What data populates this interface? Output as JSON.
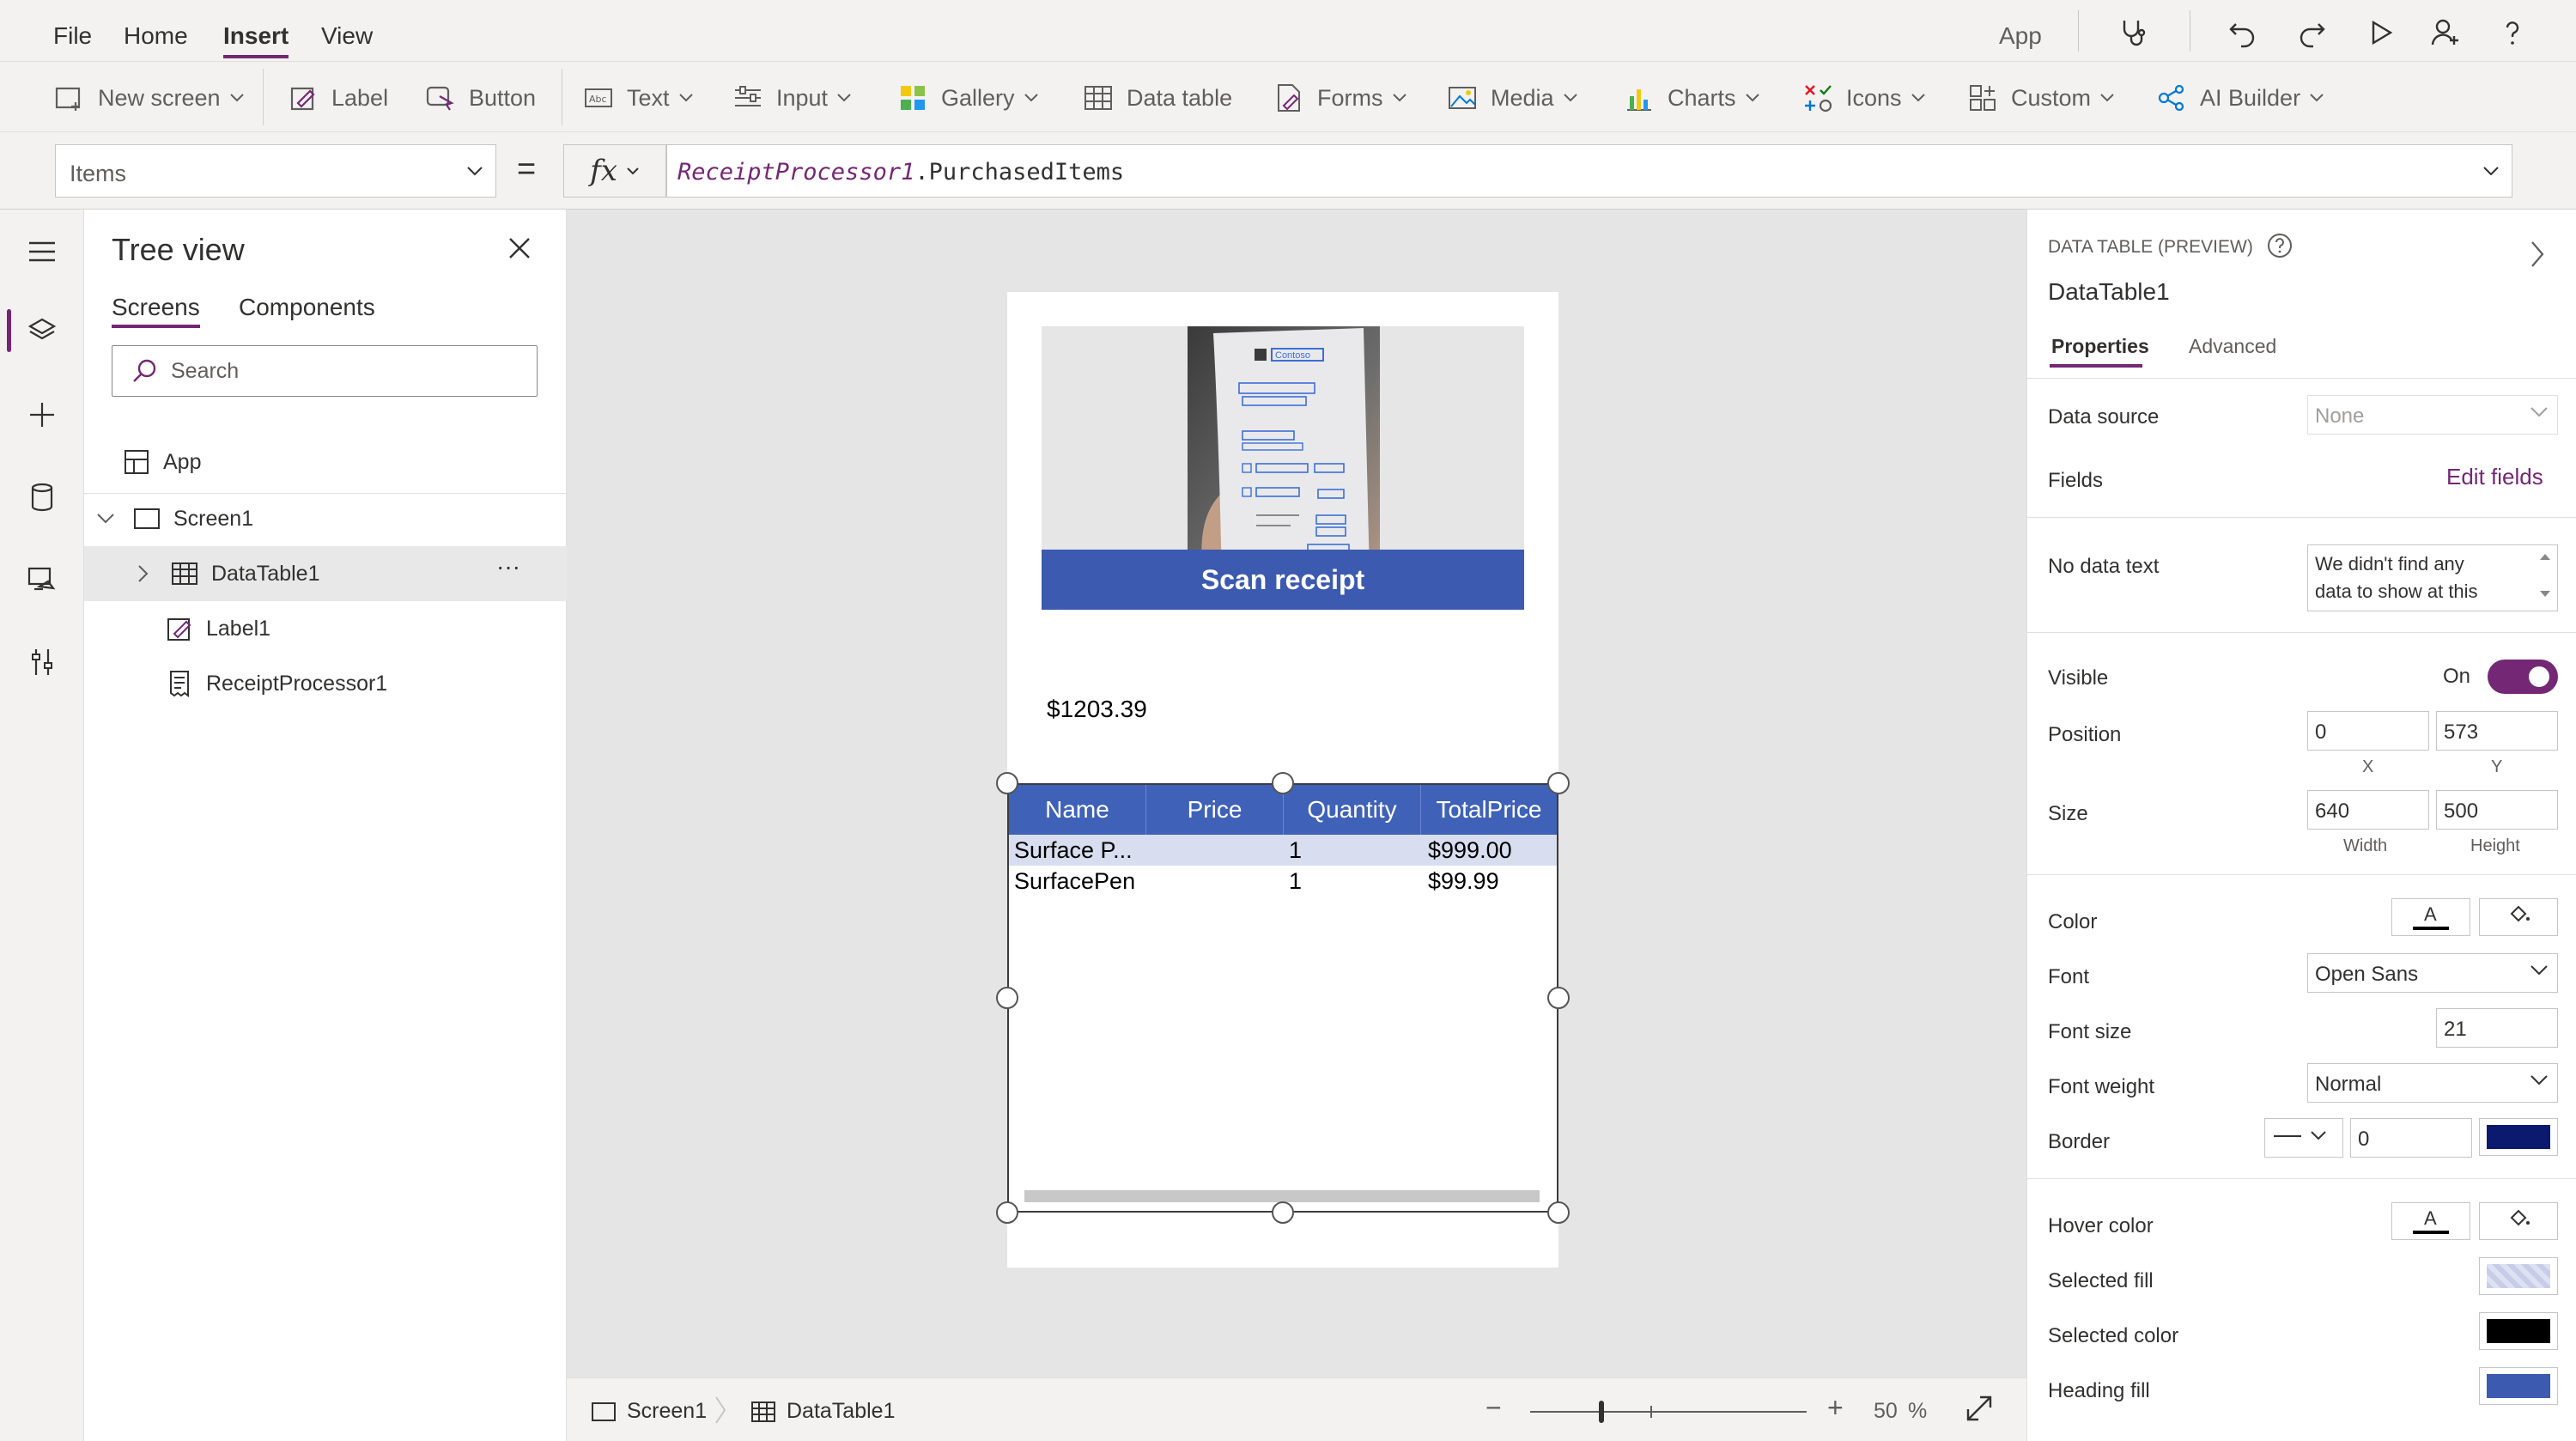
{
  "menu": {
    "file": "File",
    "home": "Home",
    "insert": "Insert",
    "view": "View",
    "app_label": "App"
  },
  "ribbon": {
    "new_screen": "New screen",
    "label": "Label",
    "button": "Button",
    "text": "Text",
    "input": "Input",
    "gallery": "Gallery",
    "data_table": "Data table",
    "forms": "Forms",
    "media": "Media",
    "charts": "Charts",
    "icons": "Icons",
    "custom": "Custom",
    "ai_builder": "AI Builder"
  },
  "formula": {
    "property": "Items",
    "equals": "=",
    "fx": "fx",
    "object": "ReceiptProcessor1",
    "member": ".PurchasedItems"
  },
  "tree": {
    "title": "Tree view",
    "tabs": [
      "Screens",
      "Components"
    ],
    "search_placeholder": "Search",
    "items": {
      "app": "App",
      "screen1": "Screen1",
      "datatable1": "DataTable1",
      "label1": "Label1",
      "receipt": "ReceiptProcessor1"
    },
    "more": "···"
  },
  "canvas": {
    "scan_button": "Scan receipt",
    "total": "$1203.39",
    "receipt_brand": "Contoso",
    "table": {
      "headers": [
        "Name",
        "Price",
        "Quantity",
        "TotalPrice"
      ],
      "rows": [
        [
          "Surface P...",
          "",
          "1",
          "$999.00"
        ],
        [
          "SurfacePen",
          "",
          "1",
          "$99.99"
        ]
      ]
    }
  },
  "status": {
    "screen": "Screen1",
    "control": "DataTable1",
    "minus": "−",
    "plus": "+",
    "zoom": "50",
    "zoom_unit": "%"
  },
  "props": {
    "type": "DATA TABLE (PREVIEW)",
    "name": "DataTable1",
    "tabs": [
      "Properties",
      "Advanced"
    ],
    "data_source_label": "Data source",
    "data_source_value": "None",
    "fields_label": "Fields",
    "edit_fields": "Edit fields",
    "no_data_label": "No data text",
    "no_data_value_1": "We didn't find any",
    "no_data_value_2": "data to show at this",
    "visible_label": "Visible",
    "visible_value": "On",
    "position_label": "Position",
    "pos_x": "0",
    "pos_y": "573",
    "x_caption": "X",
    "y_caption": "Y",
    "size_label": "Size",
    "width": "640",
    "height": "500",
    "width_caption": "Width",
    "height_caption": "Height",
    "color_label": "Color",
    "font_label": "Font",
    "font_value": "Open Sans",
    "font_size_label": "Font size",
    "font_size_value": "21",
    "font_weight_label": "Font weight",
    "font_weight_value": "Normal",
    "border_label": "Border",
    "border_value": "0",
    "hover_color_label": "Hover color",
    "selected_fill_label": "Selected fill",
    "selected_color_label": "Selected color",
    "heading_fill_label": "Heading fill",
    "colors": {
      "accent": "#742774",
      "border_color": "#0b1a6e",
      "selected_color": "#000000",
      "heading_fill": "#3c5ab0",
      "selected_fill": "#c7cde8"
    }
  },
  "theme": {
    "scan_button_bg": "#3c5ab0",
    "table_header_bg": "#3f62b8"
  }
}
